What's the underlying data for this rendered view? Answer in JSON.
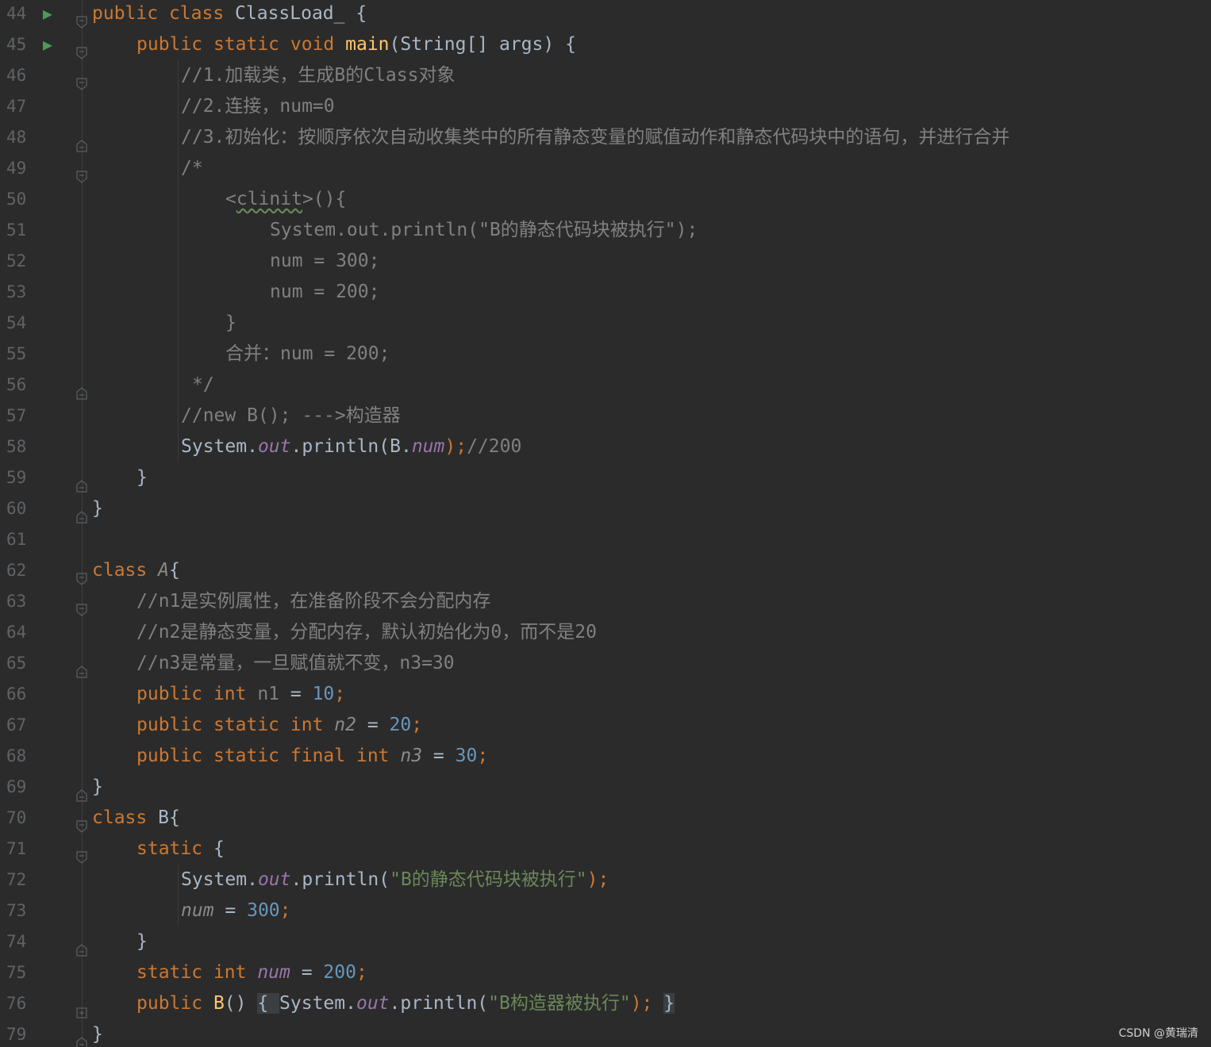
{
  "watermark": "CSDN @黄瑞清",
  "colors": {
    "background": "#2b2b2b",
    "keyword": "#cc7832",
    "comment": "#808080",
    "string": "#6a8759",
    "number": "#6897bb",
    "method": "#ffc66d",
    "field": "#9876aa",
    "text": "#a9b7c6",
    "line_number": "#606366",
    "run_icon": "#499c54"
  },
  "lines": [
    {
      "num": "44",
      "run": true,
      "fold": "open",
      "indent": 0,
      "tokens": [
        {
          "t": "public ",
          "c": "kw"
        },
        {
          "t": "class ",
          "c": "kw"
        },
        {
          "t": "ClassLoad_ {",
          "c": "plain"
        }
      ]
    },
    {
      "num": "45",
      "run": true,
      "fold": "open",
      "indent": 4,
      "tokens": [
        {
          "t": "public ",
          "c": "kw"
        },
        {
          "t": "static ",
          "c": "kw"
        },
        {
          "t": "void ",
          "c": "kw"
        },
        {
          "t": "main",
          "c": "fn"
        },
        {
          "t": "(String[] args) {",
          "c": "plain"
        }
      ]
    },
    {
      "num": "46",
      "run": false,
      "fold": "open",
      "indent": 8,
      "tokens": [
        {
          "t": "//1.加载类，生成B的Class对象",
          "c": "cm"
        }
      ]
    },
    {
      "num": "47",
      "run": false,
      "fold": "",
      "indent": 8,
      "tokens": [
        {
          "t": "//2.连接，num=0",
          "c": "cm"
        }
      ]
    },
    {
      "num": "48",
      "run": false,
      "fold": "close",
      "indent": 8,
      "tokens": [
        {
          "t": "//3.初始化：按顺序依次自动收集类中的所有静态变量的赋值动作和静态代码块中的语句，并进行合并",
          "c": "cm"
        }
      ]
    },
    {
      "num": "49",
      "run": false,
      "fold": "open",
      "indent": 8,
      "tokens": [
        {
          "t": "/*",
          "c": "cm"
        }
      ]
    },
    {
      "num": "50",
      "run": false,
      "fold": "",
      "indent": 12,
      "tokens": [
        {
          "t": "<",
          "c": "cm"
        },
        {
          "t": "clinit",
          "c": "cm sq"
        },
        {
          "t": ">(){",
          "c": "cm"
        }
      ]
    },
    {
      "num": "51",
      "run": false,
      "fold": "",
      "indent": 16,
      "tokens": [
        {
          "t": "System.out.println(\"B的静态代码块被执行\");",
          "c": "cm"
        }
      ]
    },
    {
      "num": "52",
      "run": false,
      "fold": "",
      "indent": 16,
      "tokens": [
        {
          "t": "num = 300;",
          "c": "cm"
        }
      ]
    },
    {
      "num": "53",
      "run": false,
      "fold": "",
      "indent": 16,
      "tokens": [
        {
          "t": "num = 200;",
          "c": "cm"
        }
      ]
    },
    {
      "num": "54",
      "run": false,
      "fold": "",
      "indent": 12,
      "tokens": [
        {
          "t": "}",
          "c": "cm"
        }
      ]
    },
    {
      "num": "55",
      "run": false,
      "fold": "",
      "indent": 12,
      "tokens": [
        {
          "t": "合并：num = 200;",
          "c": "cm"
        }
      ]
    },
    {
      "num": "56",
      "run": false,
      "fold": "close",
      "indent": 9,
      "tokens": [
        {
          "t": "*/",
          "c": "cm"
        }
      ]
    },
    {
      "num": "57",
      "run": false,
      "fold": "",
      "indent": 8,
      "tokens": [
        {
          "t": "//new B(); --->构造器",
          "c": "cm"
        }
      ]
    },
    {
      "num": "58",
      "run": false,
      "fold": "",
      "indent": 8,
      "tokens": [
        {
          "t": "System.",
          "c": "plain"
        },
        {
          "t": "out",
          "c": "fi"
        },
        {
          "t": ".println(B.",
          "c": "plain"
        },
        {
          "t": "num",
          "c": "fi"
        },
        {
          "t": ");",
          "c": "kw"
        },
        {
          "t": "//200",
          "c": "cm"
        }
      ]
    },
    {
      "num": "59",
      "run": false,
      "fold": "close",
      "indent": 4,
      "tokens": [
        {
          "t": "}",
          "c": "plain"
        }
      ]
    },
    {
      "num": "60",
      "run": false,
      "fold": "close",
      "indent": 0,
      "tokens": [
        {
          "t": "}",
          "c": "plain"
        }
      ]
    },
    {
      "num": "61",
      "run": false,
      "fold": "",
      "indent": 0,
      "tokens": []
    },
    {
      "num": "62",
      "run": false,
      "fold": "open",
      "indent": 0,
      "tokens": [
        {
          "t": "class ",
          "c": "kw"
        },
        {
          "t": "A",
          "c": "dim"
        },
        {
          "t": "{",
          "c": "plain"
        }
      ]
    },
    {
      "num": "63",
      "run": false,
      "fold": "open",
      "indent": 4,
      "tokens": [
        {
          "t": "//n1是实例属性，在准备阶段不会分配内存",
          "c": "cm"
        }
      ]
    },
    {
      "num": "64",
      "run": false,
      "fold": "",
      "indent": 4,
      "tokens": [
        {
          "t": "//n2是静态变量，分配内存，默认初始化为0，而不是20",
          "c": "cm"
        }
      ]
    },
    {
      "num": "65",
      "run": false,
      "fold": "close",
      "indent": 4,
      "tokens": [
        {
          "t": "//n3是常量，一旦赋值就不变，n3=30",
          "c": "cm"
        }
      ]
    },
    {
      "num": "66",
      "run": false,
      "fold": "",
      "indent": 4,
      "tokens": [
        {
          "t": "public ",
          "c": "kw"
        },
        {
          "t": "int ",
          "c": "kw"
        },
        {
          "t": "n1",
          "c": "cm"
        },
        {
          "t": " = ",
          "c": "plain"
        },
        {
          "t": "10",
          "c": "nu"
        },
        {
          "t": ";",
          "c": "kw"
        }
      ]
    },
    {
      "num": "67",
      "run": false,
      "fold": "",
      "indent": 4,
      "tokens": [
        {
          "t": "public ",
          "c": "kw"
        },
        {
          "t": "static ",
          "c": "kw"
        },
        {
          "t": "int ",
          "c": "kw"
        },
        {
          "t": "n2",
          "c": "dim"
        },
        {
          "t": " = ",
          "c": "plain"
        },
        {
          "t": "20",
          "c": "nu"
        },
        {
          "t": ";",
          "c": "kw"
        }
      ]
    },
    {
      "num": "68",
      "run": false,
      "fold": "",
      "indent": 4,
      "tokens": [
        {
          "t": "public ",
          "c": "kw"
        },
        {
          "t": "static ",
          "c": "kw"
        },
        {
          "t": "final ",
          "c": "kw"
        },
        {
          "t": "int ",
          "c": "kw"
        },
        {
          "t": "n3",
          "c": "dim"
        },
        {
          "t": " = ",
          "c": "plain"
        },
        {
          "t": "30",
          "c": "nu"
        },
        {
          "t": ";",
          "c": "kw"
        }
      ]
    },
    {
      "num": "69",
      "run": false,
      "fold": "close",
      "indent": 0,
      "tokens": [
        {
          "t": "}",
          "c": "plain"
        }
      ]
    },
    {
      "num": "70",
      "run": false,
      "fold": "open",
      "indent": 0,
      "tokens": [
        {
          "t": "class ",
          "c": "kw"
        },
        {
          "t": "B{",
          "c": "plain"
        }
      ]
    },
    {
      "num": "71",
      "run": false,
      "fold": "open",
      "indent": 4,
      "tokens": [
        {
          "t": "static ",
          "c": "kw"
        },
        {
          "t": "{",
          "c": "plain"
        }
      ]
    },
    {
      "num": "72",
      "run": false,
      "fold": "",
      "indent": 8,
      "tokens": [
        {
          "t": "System.",
          "c": "plain"
        },
        {
          "t": "out",
          "c": "fi"
        },
        {
          "t": ".println(",
          "c": "plain"
        },
        {
          "t": "\"B的静态代码块被执行\"",
          "c": "st"
        },
        {
          "t": ");",
          "c": "kw"
        }
      ]
    },
    {
      "num": "73",
      "run": false,
      "fold": "",
      "indent": 8,
      "tokens": [
        {
          "t": "num",
          "c": "dim"
        },
        {
          "t": " = ",
          "c": "plain"
        },
        {
          "t": "300",
          "c": "nu"
        },
        {
          "t": ";",
          "c": "kw"
        }
      ]
    },
    {
      "num": "74",
      "run": false,
      "fold": "close",
      "indent": 4,
      "tokens": [
        {
          "t": "}",
          "c": "plain"
        }
      ]
    },
    {
      "num": "75",
      "run": false,
      "fold": "",
      "indent": 4,
      "tokens": [
        {
          "t": "static ",
          "c": "kw"
        },
        {
          "t": "int ",
          "c": "kw"
        },
        {
          "t": "num",
          "c": "fi"
        },
        {
          "t": " = ",
          "c": "plain"
        },
        {
          "t": "200",
          "c": "nu"
        },
        {
          "t": ";",
          "c": "kw"
        }
      ]
    },
    {
      "num": "76",
      "run": false,
      "fold": "plus",
      "indent": 4,
      "tokens": [
        {
          "t": "public ",
          "c": "kw"
        },
        {
          "t": "B",
          "c": "fn"
        },
        {
          "t": "() ",
          "c": "plain"
        },
        {
          "t": "{ ",
          "c": "plain foldbox"
        },
        {
          "t": "System.",
          "c": "plain"
        },
        {
          "t": "out",
          "c": "fi"
        },
        {
          "t": ".println(",
          "c": "plain"
        },
        {
          "t": "\"B构造器被执行\"",
          "c": "st"
        },
        {
          "t": "); ",
          "c": "kw"
        },
        {
          "t": "}",
          "c": "plain foldbox"
        }
      ]
    },
    {
      "num": "79",
      "run": false,
      "fold": "close",
      "indent": 0,
      "tokens": [
        {
          "t": "}",
          "c": "plain"
        }
      ]
    }
  ]
}
